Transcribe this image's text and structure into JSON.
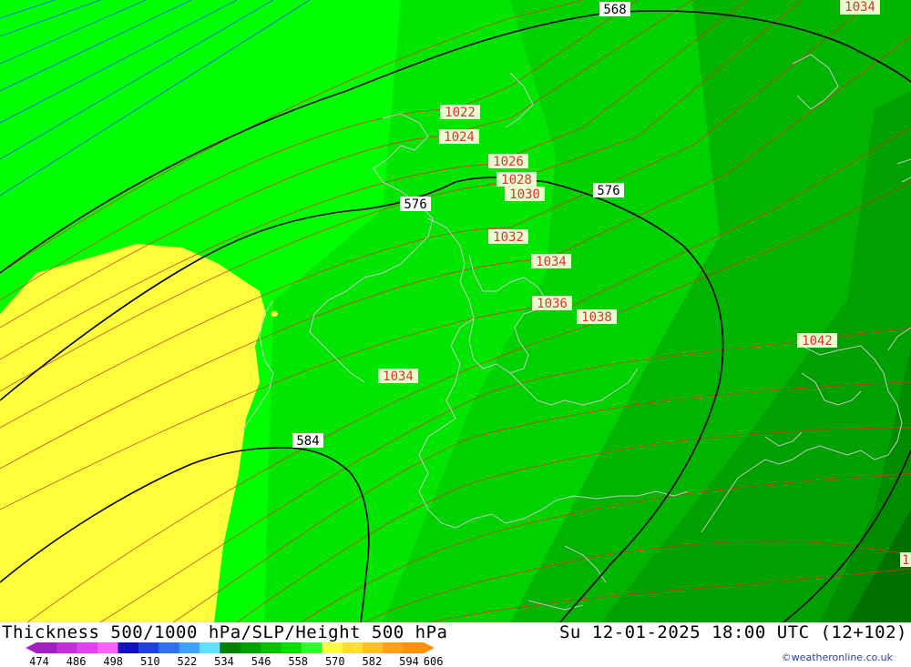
{
  "title": {
    "left": "Thickness 500/1000 hPa/SLP/Height 500 hPa",
    "right": "Su 12-01-2025 18:00 UTC (12+102)"
  },
  "credit": "©weatheronline.co.uk",
  "colors": {
    "band_546": "#00d200",
    "band_552": "#00e600",
    "band_558": "#00ff00",
    "band_564": "#00ff00",
    "band_570_yellow": "#ffff3c",
    "band_540": "#00aa00",
    "band_534": "#009600",
    "band_528": "#007800",
    "isobar": "#d23c28",
    "thickness_blue": "#2850ff",
    "height_contour": "#000000",
    "coastline": "#c8c8c8"
  },
  "height_labels": [
    "568",
    "576",
    "576",
    "584"
  ],
  "pressure_labels": [
    "1022",
    "1024",
    "1026",
    "1028",
    "1030",
    "1032",
    "1034",
    "1034",
    "1034",
    "1036",
    "1038",
    "1042",
    "1034",
    "1"
  ],
  "scale": {
    "values": [
      "474",
      "486",
      "498",
      "510",
      "522",
      "534",
      "546",
      "558",
      "570",
      "582",
      "594",
      "606"
    ],
    "colors": [
      "#a020c0",
      "#c030d8",
      "#e040f0",
      "#ff60ff",
      "#1010c0",
      "#2040e0",
      "#3070f0",
      "#40a0ff",
      "#60e0ff",
      "#008000",
      "#00a000",
      "#00c000",
      "#00e000",
      "#30ff30",
      "#ffff40",
      "#ffe030",
      "#ffc020",
      "#ffa010",
      "#ff9000"
    ]
  }
}
